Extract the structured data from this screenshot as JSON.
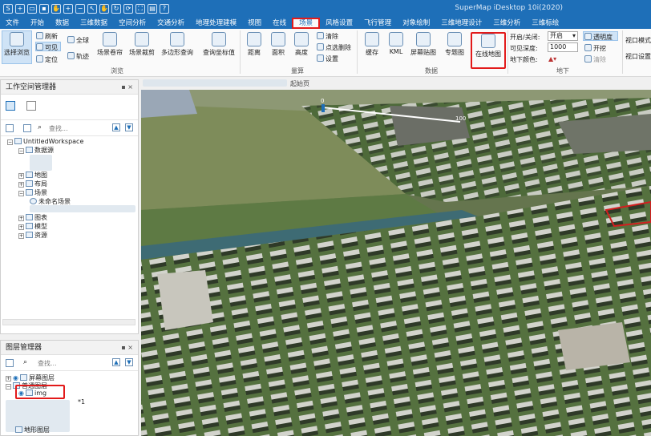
{
  "app": {
    "title": "SuperMap iDesktop 10i(2020)"
  },
  "tabs": [
    {
      "label": "文件"
    },
    {
      "label": "开始"
    },
    {
      "label": "数据"
    },
    {
      "label": "三维数据"
    },
    {
      "label": "空间分析"
    },
    {
      "label": "交通分析"
    },
    {
      "label": "地理处理建模"
    },
    {
      "label": "视图"
    },
    {
      "label": "在线"
    },
    {
      "label": "场景",
      "active": true
    },
    {
      "label": "风格设置"
    },
    {
      "label": "飞行管理"
    },
    {
      "label": "对象绘制"
    },
    {
      "label": "三维地理设计"
    },
    {
      "label": "三维分析"
    },
    {
      "label": "三维标绘"
    }
  ],
  "ribbon": {
    "browse": {
      "select_browse": "选择浏览",
      "refresh": "刷新",
      "visible": "可见",
      "locate": "定位",
      "globe": "全球",
      "trajectory": "轨迹",
      "scene_roll": "场景卷帘",
      "scene_crop": "场景裁剪",
      "polygon_query": "多边形查询",
      "query_coords": "查询坐标值",
      "group": "浏览"
    },
    "measure": {
      "distance": "距离",
      "area": "面积",
      "height": "高度",
      "clear": "清除",
      "clear_points": "点选删除",
      "settings": "设置",
      "group": "量算"
    },
    "data": {
      "cache": "缓存",
      "kml": "KML",
      "screen_map": "屏幕贴图",
      "thematic": "专题图",
      "online_map": "在线地图",
      "group": "数据"
    },
    "underground": {
      "toggle_label": "开启/关闭:",
      "toggle_value": "开启",
      "depth_label": "可见深度:",
      "depth_value": "1000",
      "color_label": "地下颜色:",
      "transparency": "透明度",
      "enable": "开挖",
      "clear": "清除",
      "group": "地下"
    },
    "viewport": {
      "vp1": "视口模式",
      "vp2": "视口设置"
    }
  },
  "doc": {
    "start_page": "起始页"
  },
  "workspace": {
    "title": "工作空间管理器",
    "search": "查找...",
    "root": "UntitledWorkspace",
    "datasource": "数据源",
    "maps": "地图",
    "layouts": "布局",
    "scenes": "场景",
    "unnamed_scene": "未命名场景",
    "charts": "图表",
    "models": "模型",
    "resources": "资源"
  },
  "layers": {
    "title": "图层管理器",
    "search": "查找...",
    "screen_layer": "屏幕图层",
    "normal_layer": "普通图层",
    "img": "img",
    "hint": "*1",
    "terrain_layer": "地形图层"
  },
  "map": {
    "scale_start": "0",
    "scale_end": "100"
  }
}
